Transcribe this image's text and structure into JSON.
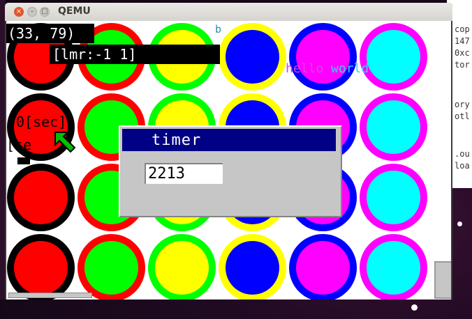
{
  "window": {
    "title": "QEMU",
    "close_glyph": "×",
    "min_glyph": "–",
    "max_glyph": "□"
  },
  "overlay": {
    "coords": "(33, 79)",
    "mouse": "[lmr:-1 1]",
    "hello": "hello",
    "world": "world",
    "mark": "b",
    "sec_line1": "0[sec]",
    "sec_line2": "[se"
  },
  "timer_dialog": {
    "title": "timer",
    "value": "2213"
  },
  "terminal_fragments": [
    "cop",
    "147",
    "0xc",
    "tor",
    "ory",
    "otl",
    ".ou",
    "loa"
  ],
  "colors": {
    "red": "#ff0000",
    "green": "#00ff00",
    "yellow": "#ffff00",
    "blue": "#0000ff",
    "magenta": "#ff00ff",
    "cyan": "#00ffff",
    "black": "#000000",
    "title_blue": "#000084"
  },
  "grid": {
    "columns": 6,
    "rows": 4,
    "cells": [
      {
        "row": 0,
        "col": 0,
        "ring": "black",
        "core": "red"
      },
      {
        "row": 0,
        "col": 1,
        "ring": "red",
        "core": "green"
      },
      {
        "row": 0,
        "col": 2,
        "ring": "green",
        "core": "yellow"
      },
      {
        "row": 0,
        "col": 3,
        "ring": "yellow",
        "core": "blue"
      },
      {
        "row": 0,
        "col": 4,
        "ring": "blue",
        "core": "magenta"
      },
      {
        "row": 0,
        "col": 5,
        "ring": "magenta",
        "core": "cyan"
      },
      {
        "row": 1,
        "col": 0,
        "ring": "black",
        "core": "red"
      },
      {
        "row": 1,
        "col": 1,
        "ring": "red",
        "core": "green"
      },
      {
        "row": 1,
        "col": 2,
        "ring": "green",
        "core": "yellow"
      },
      {
        "row": 1,
        "col": 3,
        "ring": "yellow",
        "core": "blue"
      },
      {
        "row": 1,
        "col": 4,
        "ring": "blue",
        "core": "magenta"
      },
      {
        "row": 1,
        "col": 5,
        "ring": "magenta",
        "core": "cyan"
      },
      {
        "row": 2,
        "col": 0,
        "ring": "black",
        "core": "red"
      },
      {
        "row": 2,
        "col": 1,
        "ring": "red",
        "core": "green"
      },
      {
        "row": 2,
        "col": 2,
        "ring": "green",
        "core": "yellow"
      },
      {
        "row": 2,
        "col": 3,
        "ring": "yellow",
        "core": "blue"
      },
      {
        "row": 2,
        "col": 4,
        "ring": "blue",
        "core": "magenta"
      },
      {
        "row": 2,
        "col": 5,
        "ring": "magenta",
        "core": "cyan"
      },
      {
        "row": 3,
        "col": 0,
        "ring": "black",
        "core": "red"
      },
      {
        "row": 3,
        "col": 1,
        "ring": "red",
        "core": "green"
      },
      {
        "row": 3,
        "col": 2,
        "ring": "green",
        "core": "yellow"
      },
      {
        "row": 3,
        "col": 3,
        "ring": "yellow",
        "core": "blue"
      },
      {
        "row": 3,
        "col": 4,
        "ring": "blue",
        "core": "magenta"
      },
      {
        "row": 3,
        "col": 5,
        "ring": "magenta",
        "core": "cyan"
      }
    ]
  }
}
